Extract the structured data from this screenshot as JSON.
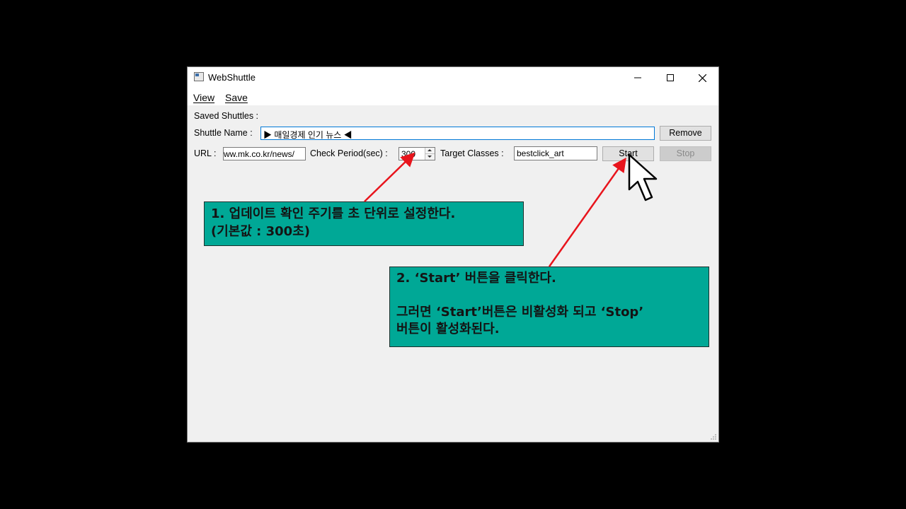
{
  "window": {
    "title": "WebShuttle",
    "controls": {
      "minimize": "—",
      "maximize": "☐",
      "close": "✕"
    }
  },
  "menu": {
    "items": [
      "View",
      "Save"
    ]
  },
  "form": {
    "saved_shuttles_label": "Saved Shuttles :",
    "shuttle_name_label": "Shuttle Name :",
    "shuttle_name_value": "▶ 매일경제 인기 뉴스 ◀",
    "remove_button": "Remove",
    "url_label": "URL :",
    "url_value": "ww.mk.co.kr/news/",
    "check_period_label": "Check Period(sec) :",
    "check_period_value": "300",
    "target_classes_label": "Target Classes :",
    "target_classes_value": "bestclick_art",
    "start_button": "Start",
    "stop_button": "Stop"
  },
  "annotations": {
    "callout1": {
      "lines": [
        "1.  업데이트 확인 주기를 초 단위로 설정한다.",
        "(기본값 : 300초)"
      ]
    },
    "callout2": {
      "lines": [
        "2.  ‘Start’ 버튼을 클릭한다.",
        "",
        "그러면 ‘Start’버튼은 비활성화 되고 ‘Stop’",
        "버튼이 활성화된다."
      ]
    },
    "colors": {
      "callout_bg": "#00a896",
      "arrow": "#e8141c"
    }
  }
}
